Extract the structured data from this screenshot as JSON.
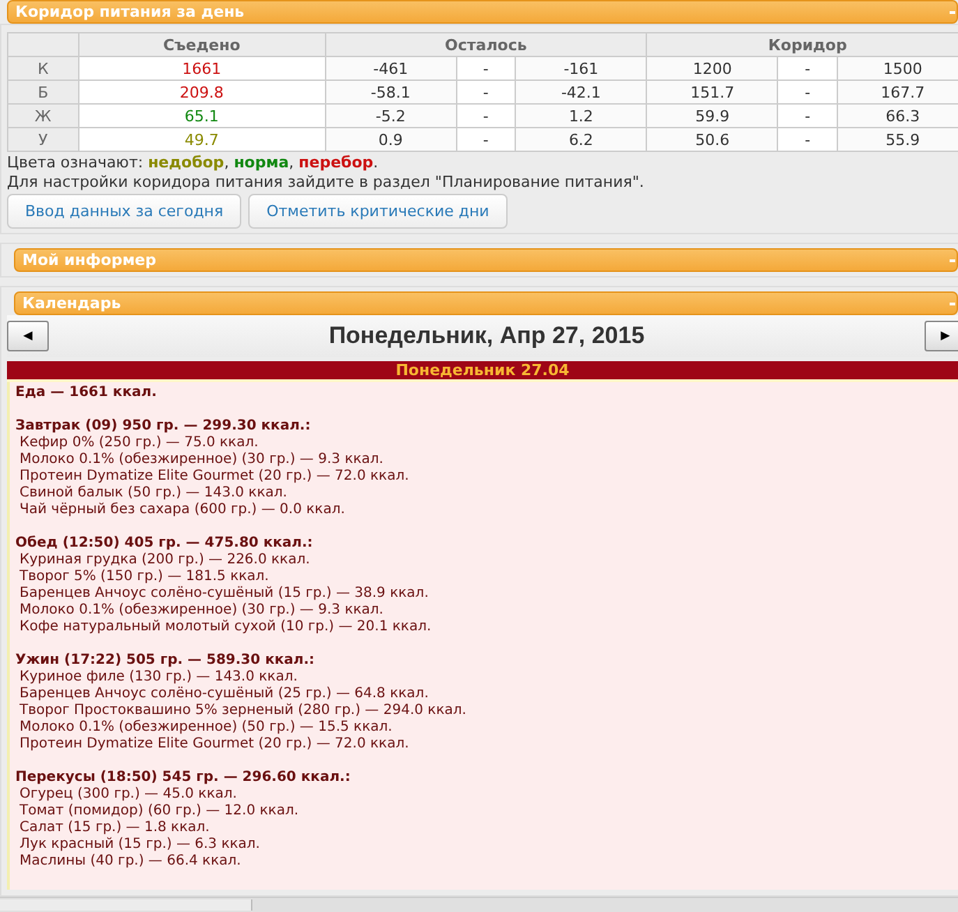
{
  "corridor_panel": {
    "title": "Коридор питания за день",
    "columns": [
      "Съедено",
      "Осталось",
      "Коридор"
    ],
    "rows": [
      {
        "label": "К",
        "eaten": "1661",
        "color": "#cc1111",
        "left_min": "-461",
        "left_sep": "-",
        "left_max": "-161",
        "corr_min": "1200",
        "corr_sep": "-",
        "corr_max": "1500"
      },
      {
        "label": "Б",
        "eaten": "209.8",
        "color": "#cc1111",
        "left_min": "-58.1",
        "left_sep": "-",
        "left_max": "-42.1",
        "corr_min": "151.7",
        "corr_sep": "-",
        "corr_max": "167.7"
      },
      {
        "label": "Ж",
        "eaten": "65.1",
        "color": "#118811",
        "left_min": "-5.2",
        "left_sep": "-",
        "left_max": "1.2",
        "corr_min": "59.9",
        "corr_sep": "-",
        "corr_max": "66.3"
      },
      {
        "label": "У",
        "eaten": "49.7",
        "color": "#8a8a00",
        "left_min": "0.9",
        "left_sep": "-",
        "left_max": "6.2",
        "corr_min": "50.6",
        "corr_sep": "-",
        "corr_max": "55.9"
      }
    ],
    "legend": {
      "prefix": "Цвета означают:",
      "items": [
        {
          "text": "недобор",
          "color": "#8a8a00",
          "after": ","
        },
        {
          "text": "норма",
          "color": "#118811",
          "after": ","
        },
        {
          "text": "перебор",
          "color": "#cc1111",
          "after": "."
        }
      ]
    },
    "hint": "Для настройки коридора питания зайдите в раздел \"Планирование питания\".",
    "buttons": [
      "Ввод данных за сегодня",
      "Отметить критические дни"
    ]
  },
  "informer_panel": {
    "title": "Мой информер"
  },
  "calendar_panel": {
    "title": "Календарь",
    "prev": "◄",
    "next": "►",
    "date": "Понедельник, Апр 27, 2015",
    "day_header": "Понедельник 27.04",
    "total": "Еда — 1661 ккал.",
    "meals": [
      {
        "title": "Завтрак (09) 950 гр. — 299.30 ккал.:",
        "items": [
          "Кефир 0% (250 гр.) — 75.0 ккал.",
          "Молоко 0.1% (обезжиренное) (30 гр.) — 9.3 ккал.",
          "Протеин Dymatize Elite Gourmet (20 гр.) — 72.0 ккал.",
          "Свиной балык (50 гр.) — 143.0 ккал.",
          "Чай чёрный без сахара (600 гр.) — 0.0 ккал."
        ]
      },
      {
        "title": "Обед (12:50) 405 гр. — 475.80 ккал.:",
        "items": [
          "Куриная грудка (200 гр.) — 226.0 ккал.",
          "Творог 5% (150 гр.) — 181.5 ккал.",
          "Баренцев Анчоус солёно-сушёный (15 гр.) — 38.9 ккал.",
          "Молоко 0.1% (обезжиренное) (30 гр.) — 9.3 ккал.",
          "Кофе натуральный молотый сухой (10 гр.) — 20.1 ккал."
        ]
      },
      {
        "title": "Ужин (17:22) 505 гр. — 589.30 ккал.:",
        "items": [
          "Куриное филе (130 гр.) — 143.0 ккал.",
          "Баренцев Анчоус солёно-сушёный (25 гр.) — 64.8 ккал.",
          "Творог Простоквашино 5% зерненый (280 гр.) — 294.0 ккал.",
          "Молоко 0.1% (обезжиренное) (50 гр.) — 15.5 ккал.",
          "Протеин Dymatize Elite Gourmet (20 гр.) — 72.0 ккал."
        ]
      },
      {
        "title": "Перекусы (18:50) 545 гр. — 296.60 ккал.:",
        "items": [
          "Огурец (300 гр.) — 45.0 ккал.",
          "Томат (помидор) (60 гр.) — 12.0 ккал.",
          "Салат (15 гр.) — 1.8 ккал.",
          "Лук красный (15 гр.) — 6.3 ккал.",
          "Маслины (40 гр.) — 66.4 ккал."
        ]
      }
    ]
  }
}
